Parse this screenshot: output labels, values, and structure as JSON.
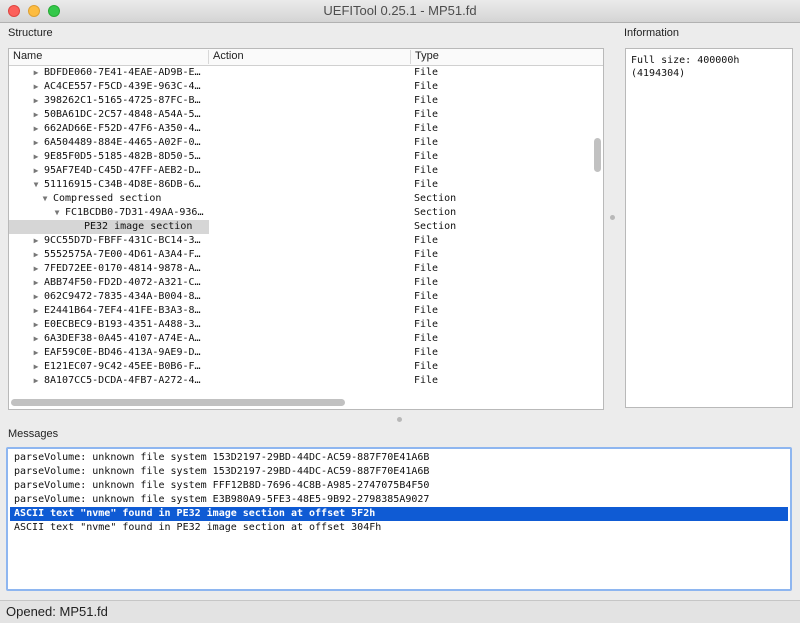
{
  "window": {
    "title": "UEFITool 0.25.1 - MP51.fd"
  },
  "structure": {
    "label": "Structure",
    "columns": {
      "name": "Name",
      "action": "Action",
      "type": "Type"
    },
    "rows": [
      {
        "name": "BDFDE060-7E41-4EAE-AD9B-E…",
        "type": "File",
        "level": 1,
        "arrow": "right",
        "selected": false
      },
      {
        "name": "AC4CE557-F5CD-439E-963C-4…",
        "type": "File",
        "level": 1,
        "arrow": "right",
        "selected": false
      },
      {
        "name": "398262C1-5165-4725-87FC-B…",
        "type": "File",
        "level": 1,
        "arrow": "right",
        "selected": false
      },
      {
        "name": "50BA61DC-2C57-4848-A54A-5…",
        "type": "File",
        "level": 1,
        "arrow": "right",
        "selected": false
      },
      {
        "name": "662AD66E-F52D-47F6-A350-4…",
        "type": "File",
        "level": 1,
        "arrow": "right",
        "selected": false
      },
      {
        "name": "6A504489-884E-4465-A02F-0…",
        "type": "File",
        "level": 1,
        "arrow": "right",
        "selected": false
      },
      {
        "name": "9E85F0D5-5185-482B-8D50-5…",
        "type": "File",
        "level": 1,
        "arrow": "right",
        "selected": false
      },
      {
        "name": "95AF7E4D-C45D-47FF-AEB2-D…",
        "type": "File",
        "level": 1,
        "arrow": "right",
        "selected": false
      },
      {
        "name": "51116915-C34B-4D8E-86DB-6…",
        "type": "File",
        "level": 1,
        "arrow": "down",
        "selected": false
      },
      {
        "name": "Compressed section",
        "type": "Section",
        "level": 2,
        "arrow": "down",
        "selected": false
      },
      {
        "name": "FC1BCDB0-7D31-49AA-936…",
        "type": "Section",
        "level": 3,
        "arrow": "down",
        "selected": false
      },
      {
        "name": "PE32 image section",
        "type": "Section",
        "level": 4,
        "arrow": "none",
        "selected": true
      },
      {
        "name": "9CC55D7D-FBFF-431C-BC14-3…",
        "type": "File",
        "level": 1,
        "arrow": "right",
        "selected": false
      },
      {
        "name": "5552575A-7E00-4D61-A3A4-F…",
        "type": "File",
        "level": 1,
        "arrow": "right",
        "selected": false
      },
      {
        "name": "7FED72EE-0170-4814-9878-A…",
        "type": "File",
        "level": 1,
        "arrow": "right",
        "selected": false
      },
      {
        "name": "ABB74F50-FD2D-4072-A321-C…",
        "type": "File",
        "level": 1,
        "arrow": "right",
        "selected": false
      },
      {
        "name": "062C9472-7835-434A-B004-8…",
        "type": "File",
        "level": 1,
        "arrow": "right",
        "selected": false
      },
      {
        "name": "E2441B64-7EF4-41FE-B3A3-8…",
        "type": "File",
        "level": 1,
        "arrow": "right",
        "selected": false
      },
      {
        "name": "E0ECBEC9-B193-4351-A488-3…",
        "type": "File",
        "level": 1,
        "arrow": "right",
        "selected": false
      },
      {
        "name": "6A3DEF38-0A45-4107-A74E-A…",
        "type": "File",
        "level": 1,
        "arrow": "right",
        "selected": false
      },
      {
        "name": "EAF59C0E-BD46-413A-9AE9-D…",
        "type": "File",
        "level": 1,
        "arrow": "right",
        "selected": false
      },
      {
        "name": "E121EC07-9C42-45EE-B0B6-F…",
        "type": "File",
        "level": 1,
        "arrow": "right",
        "selected": false
      },
      {
        "name": "8A107CC5-DCDA-4FB7-A272-4…",
        "type": "File",
        "level": 1,
        "arrow": "right",
        "selected": false
      }
    ]
  },
  "information": {
    "label": "Information",
    "text": "Full size: 400000h\n(4194304)"
  },
  "messages": {
    "label": "Messages",
    "items": [
      {
        "text": "parseVolume: unknown file system 153D2197-29BD-44DC-AC59-887F70E41A6B",
        "selected": false
      },
      {
        "text": "parseVolume: unknown file system 153D2197-29BD-44DC-AC59-887F70E41A6B",
        "selected": false
      },
      {
        "text": "parseVolume: unknown file system FFF12B8D-7696-4C8B-A985-2747075B4F50",
        "selected": false
      },
      {
        "text": "parseVolume: unknown file system E3B980A9-5FE3-48E5-9B92-2798385A9027",
        "selected": false
      },
      {
        "text": "ASCII text \"nvme\" found in PE32 image section at offset 5F2h",
        "selected": true
      },
      {
        "text": "ASCII text \"nvme\" found in PE32 image section at offset 304Fh",
        "selected": false
      }
    ]
  },
  "status": {
    "text": "Opened: MP51.fd"
  },
  "colors": {
    "selection": "#0f5bd4",
    "tree_selection": "#d6d6d6"
  }
}
